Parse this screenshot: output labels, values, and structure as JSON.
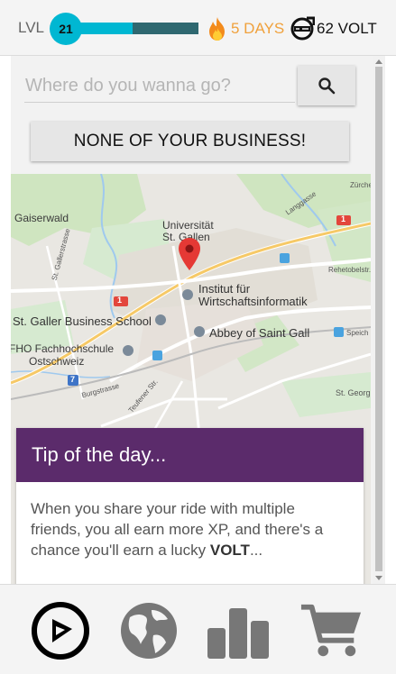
{
  "header": {
    "level_label": "LVL",
    "level": "21",
    "level_progress_fraction": 0.53,
    "streak": "5 DAYS",
    "volt": "62 VOLT",
    "colors": {
      "progress_fill": "#00b7d2",
      "progress_track": "#2f6870",
      "streak": "#f0a13c"
    },
    "icons": {
      "streak": "fire-icon",
      "volt": "volt-icon"
    }
  },
  "search": {
    "placeholder": "Where do you wanna go?",
    "value": "",
    "button_icon": "search-icon"
  },
  "secondary_button": {
    "label": "NONE OF YOUR BUSINESS!"
  },
  "map": {
    "labels": {
      "gaiserwald": "Gaiserwald",
      "universitat1": "Universität",
      "universitat2": "St. Gallen",
      "institut1": "Institut für",
      "institut2": "Wirtschaftsinformatik",
      "business_school": "St. Galler Business School",
      "fho1": "FHO Fachhochschule",
      "fho2": "Ostschweiz",
      "abbey": "Abbey of Saint Gall",
      "st_georgen": "St. Georg",
      "speich": "Speich",
      "zurcher": "Zürcher",
      "langgasse": "Langgasse",
      "rehetobel": "Rehetobelstr.",
      "gallerstrasse": "St. Gallerstrasse",
      "burgstrasse": "Burgstrasse",
      "teufener": "Teufener Str.",
      "route1a": "1",
      "route1b": "1",
      "route7": "7"
    },
    "pin_icon": "map-pin-icon"
  },
  "tip": {
    "title": "Tip of the day...",
    "text_before": "When you share your ride with multiple friends, you all earn more XP, and there's a chance you'll earn a lucky ",
    "text_bold": "VOLT",
    "text_after": "...",
    "header_color": "#5b2b6b"
  },
  "bottom_nav": {
    "items": [
      {
        "icon": "navigate-icon",
        "active": true
      },
      {
        "icon": "globe-icon",
        "active": false
      },
      {
        "icon": "leaderboard-icon",
        "active": false
      },
      {
        "icon": "cart-icon",
        "active": false
      }
    ]
  }
}
